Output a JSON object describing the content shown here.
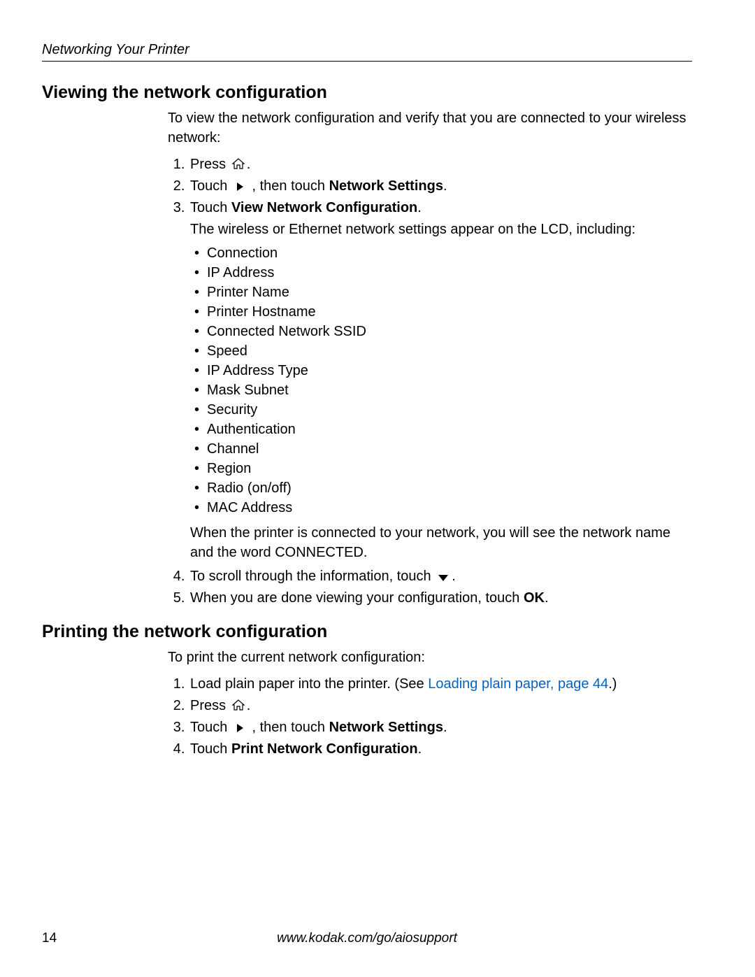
{
  "header": "Networking Your Printer",
  "section1": {
    "heading": "Viewing the network configuration",
    "intro": "To view the network configuration and verify that you are connected to your wireless network:",
    "step1_a": "Press ",
    "step1_b": ".",
    "step2_a": "Touch ",
    "step2_b": " , then touch ",
    "step2_c": "Network Settings",
    "step2_d": ".",
    "step3_a": "Touch ",
    "step3_b": "View Network Configuration",
    "step3_c": ".",
    "step3_desc": "The wireless or Ethernet network settings appear on the LCD, including:",
    "bullets": [
      "Connection",
      "IP Address",
      "Printer Name",
      "Printer Hostname",
      "Connected Network SSID",
      "Speed",
      "IP Address Type",
      "Mask Subnet",
      "Security",
      "Authentication",
      "Channel",
      "Region",
      "Radio (on/off)",
      "MAC Address"
    ],
    "connected_note": "When the printer is connected to your network, you will see the network name and the word CONNECTED.",
    "step4_a": "To scroll through the information, touch ",
    "step4_b": ".",
    "step5_a": "When you are done viewing your configuration, touch ",
    "step5_b": "OK",
    "step5_c": "."
  },
  "section2": {
    "heading": "Printing the network configuration",
    "intro": "To print the current network configuration:",
    "step1_a": "Load plain paper into the printer. (See ",
    "step1_link": "Loading plain paper, page 44",
    "step1_b": ".)",
    "step2_a": "Press ",
    "step2_b": ".",
    "step3_a": "Touch ",
    "step3_b": " , then touch ",
    "step3_c": "Network Settings",
    "step3_d": ".",
    "step4_a": "Touch ",
    "step4_b": "Print Network Configuration",
    "step4_c": "."
  },
  "footer": {
    "page": "14",
    "url": "www.kodak.com/go/aiosupport"
  }
}
